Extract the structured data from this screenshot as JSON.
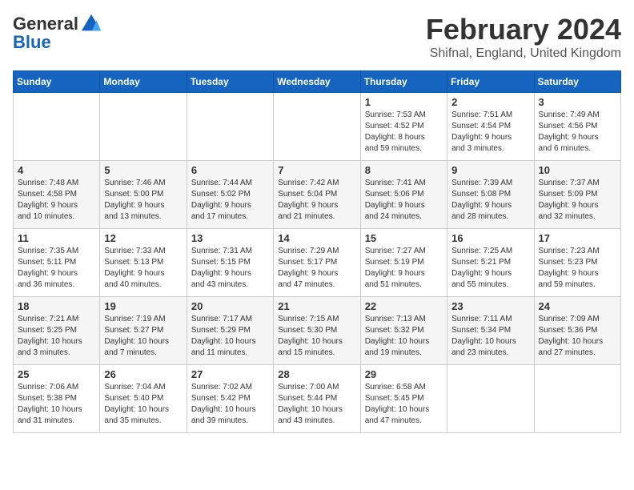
{
  "header": {
    "logo_general": "General",
    "logo_blue": "Blue",
    "title": "February 2024",
    "location": "Shifnal, England, United Kingdom"
  },
  "days_of_week": [
    "Sunday",
    "Monday",
    "Tuesday",
    "Wednesday",
    "Thursday",
    "Friday",
    "Saturday"
  ],
  "weeks": [
    [
      {
        "day": "",
        "info": ""
      },
      {
        "day": "",
        "info": ""
      },
      {
        "day": "",
        "info": ""
      },
      {
        "day": "",
        "info": ""
      },
      {
        "day": "1",
        "info": "Sunrise: 7:53 AM\nSunset: 4:52 PM\nDaylight: 8 hours\nand 59 minutes."
      },
      {
        "day": "2",
        "info": "Sunrise: 7:51 AM\nSunset: 4:54 PM\nDaylight: 9 hours\nand 3 minutes."
      },
      {
        "day": "3",
        "info": "Sunrise: 7:49 AM\nSunset: 4:56 PM\nDaylight: 9 hours\nand 6 minutes."
      }
    ],
    [
      {
        "day": "4",
        "info": "Sunrise: 7:48 AM\nSunset: 4:58 PM\nDaylight: 9 hours\nand 10 minutes."
      },
      {
        "day": "5",
        "info": "Sunrise: 7:46 AM\nSunset: 5:00 PM\nDaylight: 9 hours\nand 13 minutes."
      },
      {
        "day": "6",
        "info": "Sunrise: 7:44 AM\nSunset: 5:02 PM\nDaylight: 9 hours\nand 17 minutes."
      },
      {
        "day": "7",
        "info": "Sunrise: 7:42 AM\nSunset: 5:04 PM\nDaylight: 9 hours\nand 21 minutes."
      },
      {
        "day": "8",
        "info": "Sunrise: 7:41 AM\nSunset: 5:06 PM\nDaylight: 9 hours\nand 24 minutes."
      },
      {
        "day": "9",
        "info": "Sunrise: 7:39 AM\nSunset: 5:08 PM\nDaylight: 9 hours\nand 28 minutes."
      },
      {
        "day": "10",
        "info": "Sunrise: 7:37 AM\nSunset: 5:09 PM\nDaylight: 9 hours\nand 32 minutes."
      }
    ],
    [
      {
        "day": "11",
        "info": "Sunrise: 7:35 AM\nSunset: 5:11 PM\nDaylight: 9 hours\nand 36 minutes."
      },
      {
        "day": "12",
        "info": "Sunrise: 7:33 AM\nSunset: 5:13 PM\nDaylight: 9 hours\nand 40 minutes."
      },
      {
        "day": "13",
        "info": "Sunrise: 7:31 AM\nSunset: 5:15 PM\nDaylight: 9 hours\nand 43 minutes."
      },
      {
        "day": "14",
        "info": "Sunrise: 7:29 AM\nSunset: 5:17 PM\nDaylight: 9 hours\nand 47 minutes."
      },
      {
        "day": "15",
        "info": "Sunrise: 7:27 AM\nSunset: 5:19 PM\nDaylight: 9 hours\nand 51 minutes."
      },
      {
        "day": "16",
        "info": "Sunrise: 7:25 AM\nSunset: 5:21 PM\nDaylight: 9 hours\nand 55 minutes."
      },
      {
        "day": "17",
        "info": "Sunrise: 7:23 AM\nSunset: 5:23 PM\nDaylight: 9 hours\nand 59 minutes."
      }
    ],
    [
      {
        "day": "18",
        "info": "Sunrise: 7:21 AM\nSunset: 5:25 PM\nDaylight: 10 hours\nand 3 minutes."
      },
      {
        "day": "19",
        "info": "Sunrise: 7:19 AM\nSunset: 5:27 PM\nDaylight: 10 hours\nand 7 minutes."
      },
      {
        "day": "20",
        "info": "Sunrise: 7:17 AM\nSunset: 5:29 PM\nDaylight: 10 hours\nand 11 minutes."
      },
      {
        "day": "21",
        "info": "Sunrise: 7:15 AM\nSunset: 5:30 PM\nDaylight: 10 hours\nand 15 minutes."
      },
      {
        "day": "22",
        "info": "Sunrise: 7:13 AM\nSunset: 5:32 PM\nDaylight: 10 hours\nand 19 minutes."
      },
      {
        "day": "23",
        "info": "Sunrise: 7:11 AM\nSunset: 5:34 PM\nDaylight: 10 hours\nand 23 minutes."
      },
      {
        "day": "24",
        "info": "Sunrise: 7:09 AM\nSunset: 5:36 PM\nDaylight: 10 hours\nand 27 minutes."
      }
    ],
    [
      {
        "day": "25",
        "info": "Sunrise: 7:06 AM\nSunset: 5:38 PM\nDaylight: 10 hours\nand 31 minutes."
      },
      {
        "day": "26",
        "info": "Sunrise: 7:04 AM\nSunset: 5:40 PM\nDaylight: 10 hours\nand 35 minutes."
      },
      {
        "day": "27",
        "info": "Sunrise: 7:02 AM\nSunset: 5:42 PM\nDaylight: 10 hours\nand 39 minutes."
      },
      {
        "day": "28",
        "info": "Sunrise: 7:00 AM\nSunset: 5:44 PM\nDaylight: 10 hours\nand 43 minutes."
      },
      {
        "day": "29",
        "info": "Sunrise: 6:58 AM\nSunset: 5:45 PM\nDaylight: 10 hours\nand 47 minutes."
      },
      {
        "day": "",
        "info": ""
      },
      {
        "day": "",
        "info": ""
      }
    ]
  ]
}
